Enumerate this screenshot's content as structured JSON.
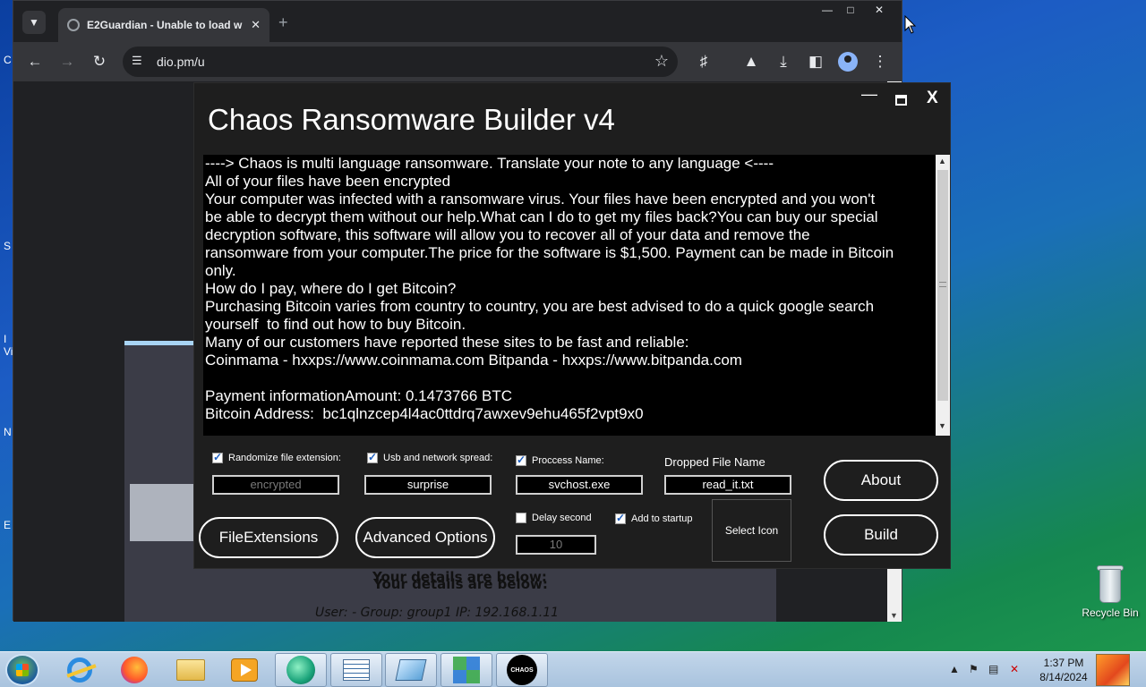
{
  "desktop": {
    "edge_fragments": [
      "C",
      "S",
      "I",
      "Vi",
      "N",
      "E"
    ],
    "recycle_bin_label": "Recycle Bin"
  },
  "browser": {
    "tab_title": "E2Guardian - Unable to load w",
    "url": "dio.pm/u",
    "page": {
      "details_title": "Your details are below:",
      "details_user": "User: -   Group: group1   IP: 192.168.1.11"
    }
  },
  "chaos": {
    "title": "Chaos Ransomware Builder v4",
    "note_lines": [
      "----> Chaos is multi language ransomware. Translate your note to any language <----",
      "All of your files have been encrypted",
      "Your computer was infected with a ransomware virus. Your files have been encrypted and you won't",
      "be able to decrypt them without our help.What can I do to get my files back?You can buy our special",
      "decryption software, this software will allow you to recover all of your data and remove the",
      "ransomware from your computer.The price for the software is $1,500. Payment can be made in Bitcoin",
      "only.",
      "How do I pay, where do I get Bitcoin?",
      "Purchasing Bitcoin varies from country to country, you are best advised to do a quick google search",
      "yourself  to find out how to buy Bitcoin.",
      "Many of our customers have reported these sites to be fast and reliable:",
      "Coinmama - hxxps://www.coinmama.com Bitpanda - hxxps://www.bitpanda.com",
      "",
      "Payment informationAmount: 0.1473766 BTC",
      "Bitcoin Address:  bc1qlnzcep4l4ac0ttdrq7awxev9ehu465f2vpt9x0"
    ],
    "options": {
      "randomize_label": "Randomize file extension:",
      "randomize_value": "encrypted",
      "usb_label": "Usb and network spread:",
      "usb_value": "surprise",
      "process_label": "Proccess Name:",
      "process_value": "svchost.exe",
      "dropped_label": "Dropped File Name",
      "dropped_value": "read_it.txt",
      "delay_label": "Delay second",
      "delay_value": "10",
      "startup_label": "Add to startup"
    },
    "buttons": {
      "file_extensions": "FileExtensions",
      "advanced_options": "Advanced Options",
      "select_icon": "Select Icon",
      "about": "About",
      "build": "Build"
    }
  },
  "taskbar": {
    "time": "1:37 PM",
    "date": "8/14/2024",
    "chaos_icon_text": "CHAOS"
  }
}
